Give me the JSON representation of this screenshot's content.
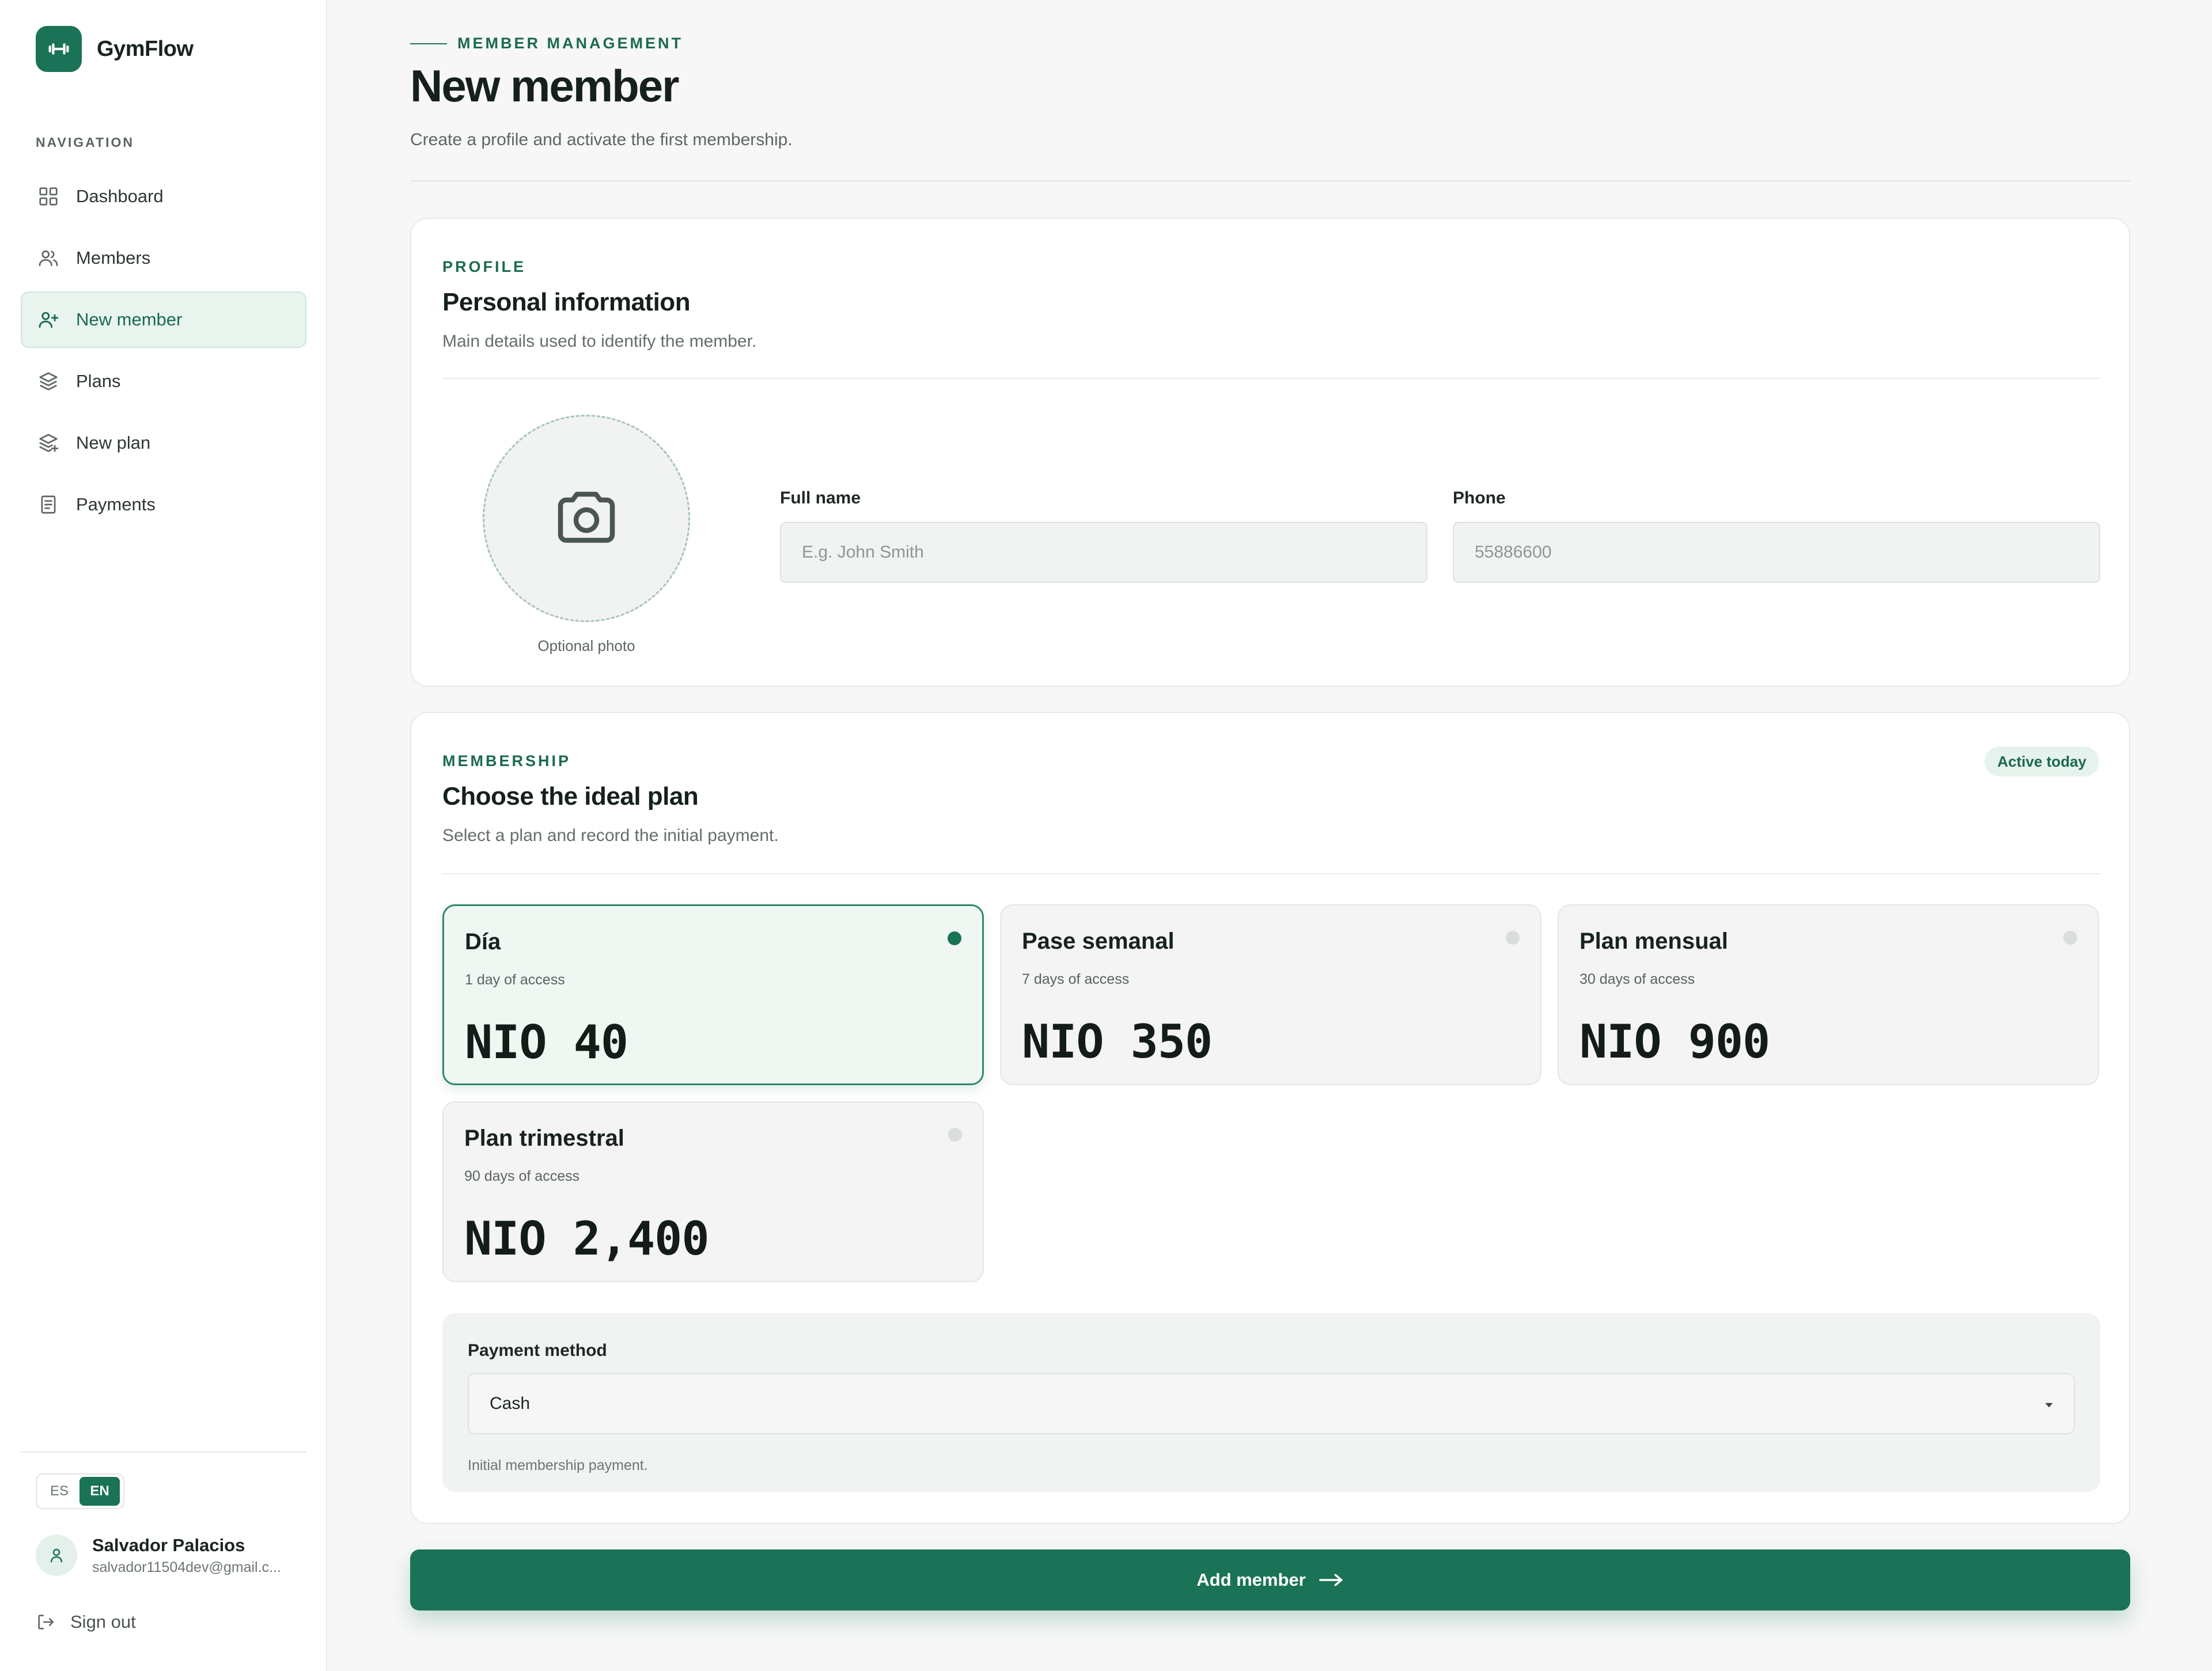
{
  "app": {
    "name": "GymFlow",
    "accent": "#1b7357",
    "logo_icon": "dumbbell-icon"
  },
  "sidebar": {
    "nav_label": "NAVIGATION",
    "items": [
      {
        "label": "Dashboard",
        "icon": "grid-icon",
        "active": false
      },
      {
        "label": "Members",
        "icon": "users-icon",
        "active": false
      },
      {
        "label": "New member",
        "icon": "user-plus-icon",
        "active": true
      },
      {
        "label": "Plans",
        "icon": "layers-icon",
        "active": false
      },
      {
        "label": "New plan",
        "icon": "layers-plus-icon",
        "active": false
      },
      {
        "label": "Payments",
        "icon": "receipt-icon",
        "active": false
      }
    ],
    "language": {
      "options": [
        "ES",
        "EN"
      ],
      "selected": "EN"
    },
    "user": {
      "name": "Salvador Palacios",
      "email": "salvador11504dev@gmail.c..."
    },
    "sign_out": "Sign out"
  },
  "header": {
    "eyebrow": "MEMBER MANAGEMENT",
    "title": "New member",
    "subtitle": "Create a profile and activate the first membership."
  },
  "profile": {
    "eyebrow": "PROFILE",
    "title": "Personal information",
    "subtitle": "Main details used to identify the member.",
    "photo_label": "Optional photo",
    "full_name": {
      "label": "Full name",
      "placeholder": "E.g. John Smith",
      "value": ""
    },
    "phone": {
      "label": "Phone",
      "placeholder": "55886600",
      "value": ""
    }
  },
  "membership": {
    "eyebrow": "MEMBERSHIP",
    "title": "Choose the ideal plan",
    "subtitle": "Select a plan and record the initial payment.",
    "badge": "Active today",
    "plans": [
      {
        "name": "Día",
        "days": "1 day of access",
        "price": "NIO 40",
        "selected": true
      },
      {
        "name": "Pase semanal",
        "days": "7 days of access",
        "price": "NIO 350",
        "selected": false
      },
      {
        "name": "Plan mensual",
        "days": "30 days of access",
        "price": "NIO 900",
        "selected": false
      },
      {
        "name": "Plan trimestral",
        "days": "90 days of access",
        "price": "NIO 2,400",
        "selected": false
      }
    ],
    "payment": {
      "label": "Payment method",
      "selected": "Cash",
      "help": "Initial membership payment."
    }
  },
  "submit": {
    "label": "Add member"
  }
}
